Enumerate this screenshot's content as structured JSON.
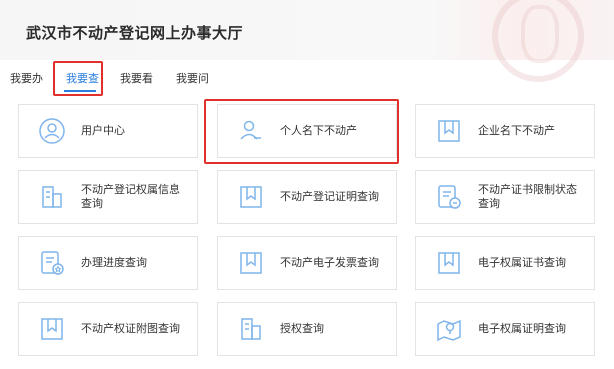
{
  "header": {
    "title": "武汉市不动产登记网上办事大厅"
  },
  "tabs": [
    {
      "label": "我要办"
    },
    {
      "label": "我要查"
    },
    {
      "label": "我要看"
    },
    {
      "label": "我要问"
    }
  ],
  "active_tab": "我要查",
  "cards": [
    {
      "label": "用户中心",
      "icon": "user-circle-icon"
    },
    {
      "label": "个人名下不动产",
      "icon": "person-icon"
    },
    {
      "label": "企业名下不动产",
      "icon": "bookmark-icon"
    },
    {
      "label": "不动产登记权属信息查询",
      "icon": "building-icon"
    },
    {
      "label": "不动产登记证明查询",
      "icon": "bookmark-icon"
    },
    {
      "label": "不动产证书限制状态查询",
      "icon": "document-lock-icon"
    },
    {
      "label": "办理进度查询",
      "icon": "document-star-icon"
    },
    {
      "label": "不动产电子发票查询",
      "icon": "bookmark-icon"
    },
    {
      "label": "电子权属证书查询",
      "icon": "bookmark-icon"
    },
    {
      "label": "不动产权证附图查询",
      "icon": "bookmark-icon"
    },
    {
      "label": "授权查询",
      "icon": "building-icon"
    },
    {
      "label": "电子权属证明查询",
      "icon": "map-pin-icon"
    }
  ],
  "colors": {
    "accent": "#2a7ee0",
    "highlight": "#e0302b",
    "icon": "#7fb5ea"
  }
}
